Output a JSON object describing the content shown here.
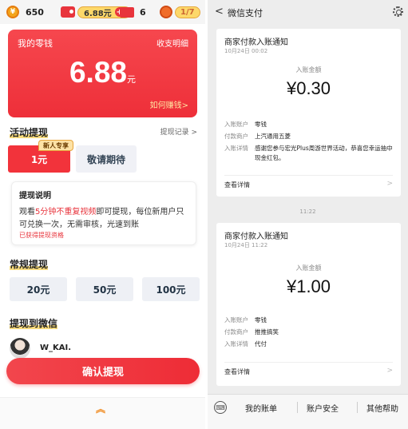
{
  "left": {
    "topbar": {
      "coins": "650",
      "coin_icon_text": "¥",
      "money": "6.88元",
      "money_plus": "+",
      "cards": "6",
      "time": "1/7"
    },
    "card": {
      "title": "我的零钱",
      "detail_link": "收支明细",
      "amount": "6.88",
      "unit": "元",
      "earn_link": "如何赚钱>"
    },
    "activity": {
      "title": "活动提现",
      "record_link": "提现记录 >",
      "new_tag": "新人专享",
      "option1": "1元",
      "option2": "敬请期待"
    },
    "notice": {
      "title": "提现说明",
      "text_pre": "观看",
      "text_highlight": "5分钟不重复视频",
      "text_post": "即可提现，每位新用户只可兑换一次，无需审核，光速到账",
      "qualified": "已获得提现资格"
    },
    "regular": {
      "title": "常规提现",
      "options": [
        "20元",
        "50元",
        "100元"
      ]
    },
    "wechat": {
      "title": "提现到微信",
      "username": "W_KAI.",
      "confirm": "确认提现"
    },
    "bottom_chevron": "︽"
  },
  "right": {
    "header": {
      "back": "<",
      "title": "微信支付"
    },
    "messages": [
      {
        "title": "商家付款入账通知",
        "date": "10月24日 00:02",
        "amount_label": "入账金额",
        "amount": "¥0.30",
        "rows": [
          {
            "k": "入账账户",
            "v": "零钱"
          },
          {
            "k": "付款商户",
            "v": "上汽通用五菱"
          },
          {
            "k": "入账详情",
            "v": "感谢您参与宏光Plus周游世界活动，恭喜您幸运抽中现金红包。"
          }
        ],
        "detail": "查看详情",
        "arrow": ">"
      },
      {
        "title": "商家付款入账通知",
        "date": "10月24日 11:22",
        "amount_label": "入账金额",
        "amount": "¥1.00",
        "rows": [
          {
            "k": "入账账户",
            "v": "零钱"
          },
          {
            "k": "付款商户",
            "v": "推推搞笑"
          },
          {
            "k": "入账详情",
            "v": "代付"
          }
        ],
        "detail": "查看详情",
        "arrow": ">"
      }
    ],
    "timestamp": "11:22",
    "footer": {
      "keyboard": "⌨",
      "items": [
        "我的账单",
        "账户安全",
        "其他帮助"
      ]
    }
  },
  "colors": {
    "accent_red": "#ee2f39",
    "gold": "#fdd86a",
    "wechat_bg": "#ededed"
  }
}
